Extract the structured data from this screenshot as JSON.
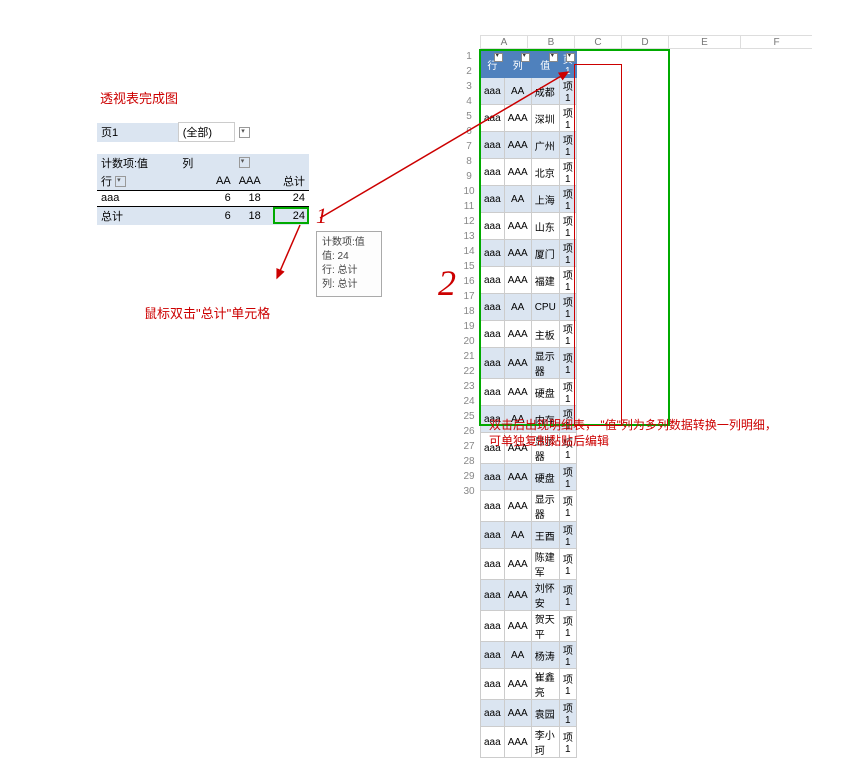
{
  "labels": {
    "title_left": "透视表完成图",
    "bottom_note": "鼠标双击\"总计\"单元格",
    "right_note_line1": "双击后出现明细表， \"值\"列为多列数据转换一列明细，",
    "right_note_line2": "可单独复制黏贴后编辑"
  },
  "pivot": {
    "page_field": "页1",
    "page_value": "(全部)",
    "data_field": "计数项:值",
    "col_field": "列",
    "row_field": "行",
    "col_headers": [
      "AA",
      "AAA",
      "总计"
    ],
    "row_label": "aaa",
    "row_vals": [
      "6",
      "18",
      "24"
    ],
    "total_label": "总计",
    "total_vals": [
      "6",
      "18",
      "24"
    ]
  },
  "tooltip": {
    "l1": "计数项:值",
    "l2": "值: 24",
    "l3": "行: 总计",
    "l4": "列: 总计"
  },
  "cols": [
    "A",
    "B",
    "C",
    "D",
    "E",
    "F"
  ],
  "col_positions": [
    21,
    68,
    115,
    162,
    209,
    281,
    353
  ],
  "headers": {
    "c1": "行",
    "c2": "列",
    "c3": "值",
    "c4": "页1"
  },
  "rows": [
    {
      "r": "aaa",
      "c": "AA",
      "v": "成都",
      "p": "项1"
    },
    {
      "r": "aaa",
      "c": "AAA",
      "v": "深圳",
      "p": "项1"
    },
    {
      "r": "aaa",
      "c": "AAA",
      "v": "广州",
      "p": "项1"
    },
    {
      "r": "aaa",
      "c": "AAA",
      "v": "北京",
      "p": "项1"
    },
    {
      "r": "aaa",
      "c": "AA",
      "v": "上海",
      "p": "项1"
    },
    {
      "r": "aaa",
      "c": "AAA",
      "v": "山东",
      "p": "项1"
    },
    {
      "r": "aaa",
      "c": "AAA",
      "v": "厦门",
      "p": "项1"
    },
    {
      "r": "aaa",
      "c": "AAA",
      "v": "福建",
      "p": "项1"
    },
    {
      "r": "aaa",
      "c": "AA",
      "v": "CPU",
      "p": "项1"
    },
    {
      "r": "aaa",
      "c": "AAA",
      "v": "主板",
      "p": "项1"
    },
    {
      "r": "aaa",
      "c": "AAA",
      "v": "显示器",
      "p": "项1"
    },
    {
      "r": "aaa",
      "c": "AAA",
      "v": "硬盘",
      "p": "项1"
    },
    {
      "r": "aaa",
      "c": "AA",
      "v": "内存",
      "p": "项1"
    },
    {
      "r": "aaa",
      "c": "AAA",
      "v": "显示器",
      "p": "项1"
    },
    {
      "r": "aaa",
      "c": "AAA",
      "v": "硬盘",
      "p": "项1"
    },
    {
      "r": "aaa",
      "c": "AAA",
      "v": "显示器",
      "p": "项1"
    },
    {
      "r": "aaa",
      "c": "AA",
      "v": "王酉",
      "p": "项1"
    },
    {
      "r": "aaa",
      "c": "AAA",
      "v": "陈建军",
      "p": "项1"
    },
    {
      "r": "aaa",
      "c": "AAA",
      "v": "刘怀安",
      "p": "项1"
    },
    {
      "r": "aaa",
      "c": "AAA",
      "v": "贺天平",
      "p": "项1"
    },
    {
      "r": "aaa",
      "c": "AA",
      "v": "杨涛",
      "p": "项1"
    },
    {
      "r": "aaa",
      "c": "AAA",
      "v": "崔鑫亮",
      "p": "项1"
    },
    {
      "r": "aaa",
      "c": "AAA",
      "v": "袁园",
      "p": "项1"
    },
    {
      "r": "aaa",
      "c": "AAA",
      "v": "李小珂",
      "p": "项1"
    }
  ]
}
